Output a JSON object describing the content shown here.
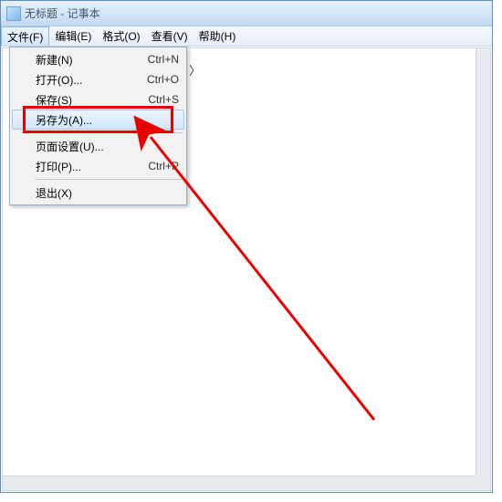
{
  "window": {
    "title": "无标题 - 记事本"
  },
  "menubar": {
    "items": [
      {
        "label": "文件(F)"
      },
      {
        "label": "编辑(E)"
      },
      {
        "label": "格式(O)"
      },
      {
        "label": "查看(V)"
      },
      {
        "label": "帮助(H)"
      }
    ]
  },
  "file_menu": {
    "new": {
      "label": "新建(N)",
      "shortcut": "Ctrl+N"
    },
    "open": {
      "label": "打开(O)...",
      "shortcut": "Ctrl+O"
    },
    "save": {
      "label": "保存(S)",
      "shortcut": "Ctrl+S"
    },
    "save_as": {
      "label": "另存为(A)...",
      "shortcut": ""
    },
    "page": {
      "label": "页面设置(U)...",
      "shortcut": ""
    },
    "print": {
      "label": "打印(P)...",
      "shortcut": "Ctrl+P"
    },
    "exit": {
      "label": "退出(X)",
      "shortcut": ""
    }
  },
  "content_fragment": "〉",
  "annotation": {
    "color": "#e80000"
  }
}
